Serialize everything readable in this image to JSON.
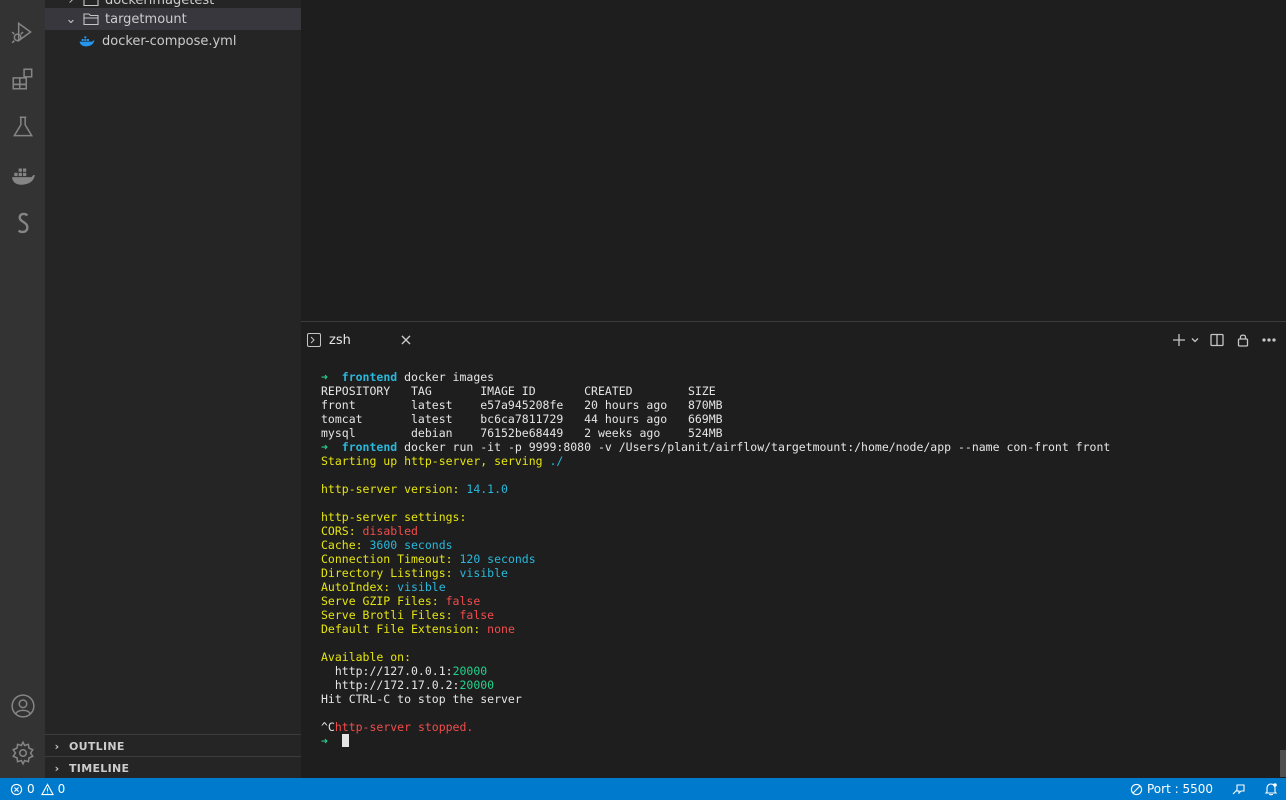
{
  "explorer": {
    "partial_item": "dockerimagetest",
    "folder": "targetmount",
    "file": "docker-compose.yml",
    "outline_label": "OUTLINE",
    "timeline_label": "TIMELINE"
  },
  "terminal": {
    "tab_label": "zsh",
    "tab_close": "×",
    "lines": [
      [
        {
          "t": "➜  ",
          "c": "c-green bold"
        },
        {
          "t": "frontend",
          "c": "c-blue bold"
        },
        {
          "t": " docker images",
          "c": "c-white"
        }
      ],
      [
        {
          "t": "REPOSITORY   TAG       IMAGE ID       CREATED        SIZE",
          "c": "c-white"
        }
      ],
      [
        {
          "t": "front        latest    e57a945208fe   20 hours ago   870MB",
          "c": "c-white"
        }
      ],
      [
        {
          "t": "tomcat       latest    bc6ca7811729   44 hours ago   669MB",
          "c": "c-white"
        }
      ],
      [
        {
          "t": "mysql        debian    76152be68449   2 weeks ago    524MB",
          "c": "c-white"
        }
      ],
      [
        {
          "t": "➜  ",
          "c": "c-green bold"
        },
        {
          "t": "frontend",
          "c": "c-blue bold"
        },
        {
          "t": " docker run -it -p 9999:8080 -v /Users/planit/airflow/targetmount:/home/node/app --name con-front front",
          "c": "c-white"
        }
      ],
      [
        {
          "t": "Starting up http-server, serving ",
          "c": "c-yellow"
        },
        {
          "t": "./",
          "c": "c-blue"
        }
      ],
      [],
      [
        {
          "t": "http-server version: ",
          "c": "c-yellow"
        },
        {
          "t": "14.1.0",
          "c": "c-blue"
        }
      ],
      [],
      [
        {
          "t": "http-server settings: ",
          "c": "c-yellow"
        }
      ],
      [
        {
          "t": "CORS: ",
          "c": "c-yellow"
        },
        {
          "t": "disabled",
          "c": "c-red"
        }
      ],
      [
        {
          "t": "Cache: ",
          "c": "c-yellow"
        },
        {
          "t": "3600 seconds",
          "c": "c-blue"
        }
      ],
      [
        {
          "t": "Connection Timeout: ",
          "c": "c-yellow"
        },
        {
          "t": "120 seconds",
          "c": "c-blue"
        }
      ],
      [
        {
          "t": "Directory Listings: ",
          "c": "c-yellow"
        },
        {
          "t": "visible",
          "c": "c-blue"
        }
      ],
      [
        {
          "t": "AutoIndex: ",
          "c": "c-yellow"
        },
        {
          "t": "visible",
          "c": "c-blue"
        }
      ],
      [
        {
          "t": "Serve GZIP Files: ",
          "c": "c-yellow"
        },
        {
          "t": "false",
          "c": "c-red"
        }
      ],
      [
        {
          "t": "Serve Brotli Files: ",
          "c": "c-yellow"
        },
        {
          "t": "false",
          "c": "c-red"
        }
      ],
      [
        {
          "t": "Default File Extension: ",
          "c": "c-yellow"
        },
        {
          "t": "none",
          "c": "c-red"
        }
      ],
      [],
      [
        {
          "t": "Available on:",
          "c": "c-yellow"
        }
      ],
      [
        {
          "t": "  http://127.0.0.1:",
          "c": "c-white"
        },
        {
          "t": "20000",
          "c": "c-green"
        }
      ],
      [
        {
          "t": "  http://172.17.0.2:",
          "c": "c-white"
        },
        {
          "t": "20000",
          "c": "c-green"
        }
      ],
      [
        {
          "t": "Hit CTRL-C to stop the server",
          "c": "c-white"
        }
      ],
      [],
      [
        {
          "t": "^C",
          "c": "c-white"
        },
        {
          "t": "http-server stopped.",
          "c": "c-red"
        }
      ],
      [
        {
          "t": "➜  ",
          "c": "c-green bold"
        }
      ]
    ]
  },
  "statusbar": {
    "errors": "0",
    "warnings": "0",
    "port": "Port : 5500"
  },
  "colors": {
    "statusbar": "#007acc",
    "activitybar": "#333333",
    "sidebar": "#252526",
    "editor": "#1e1e1e"
  }
}
